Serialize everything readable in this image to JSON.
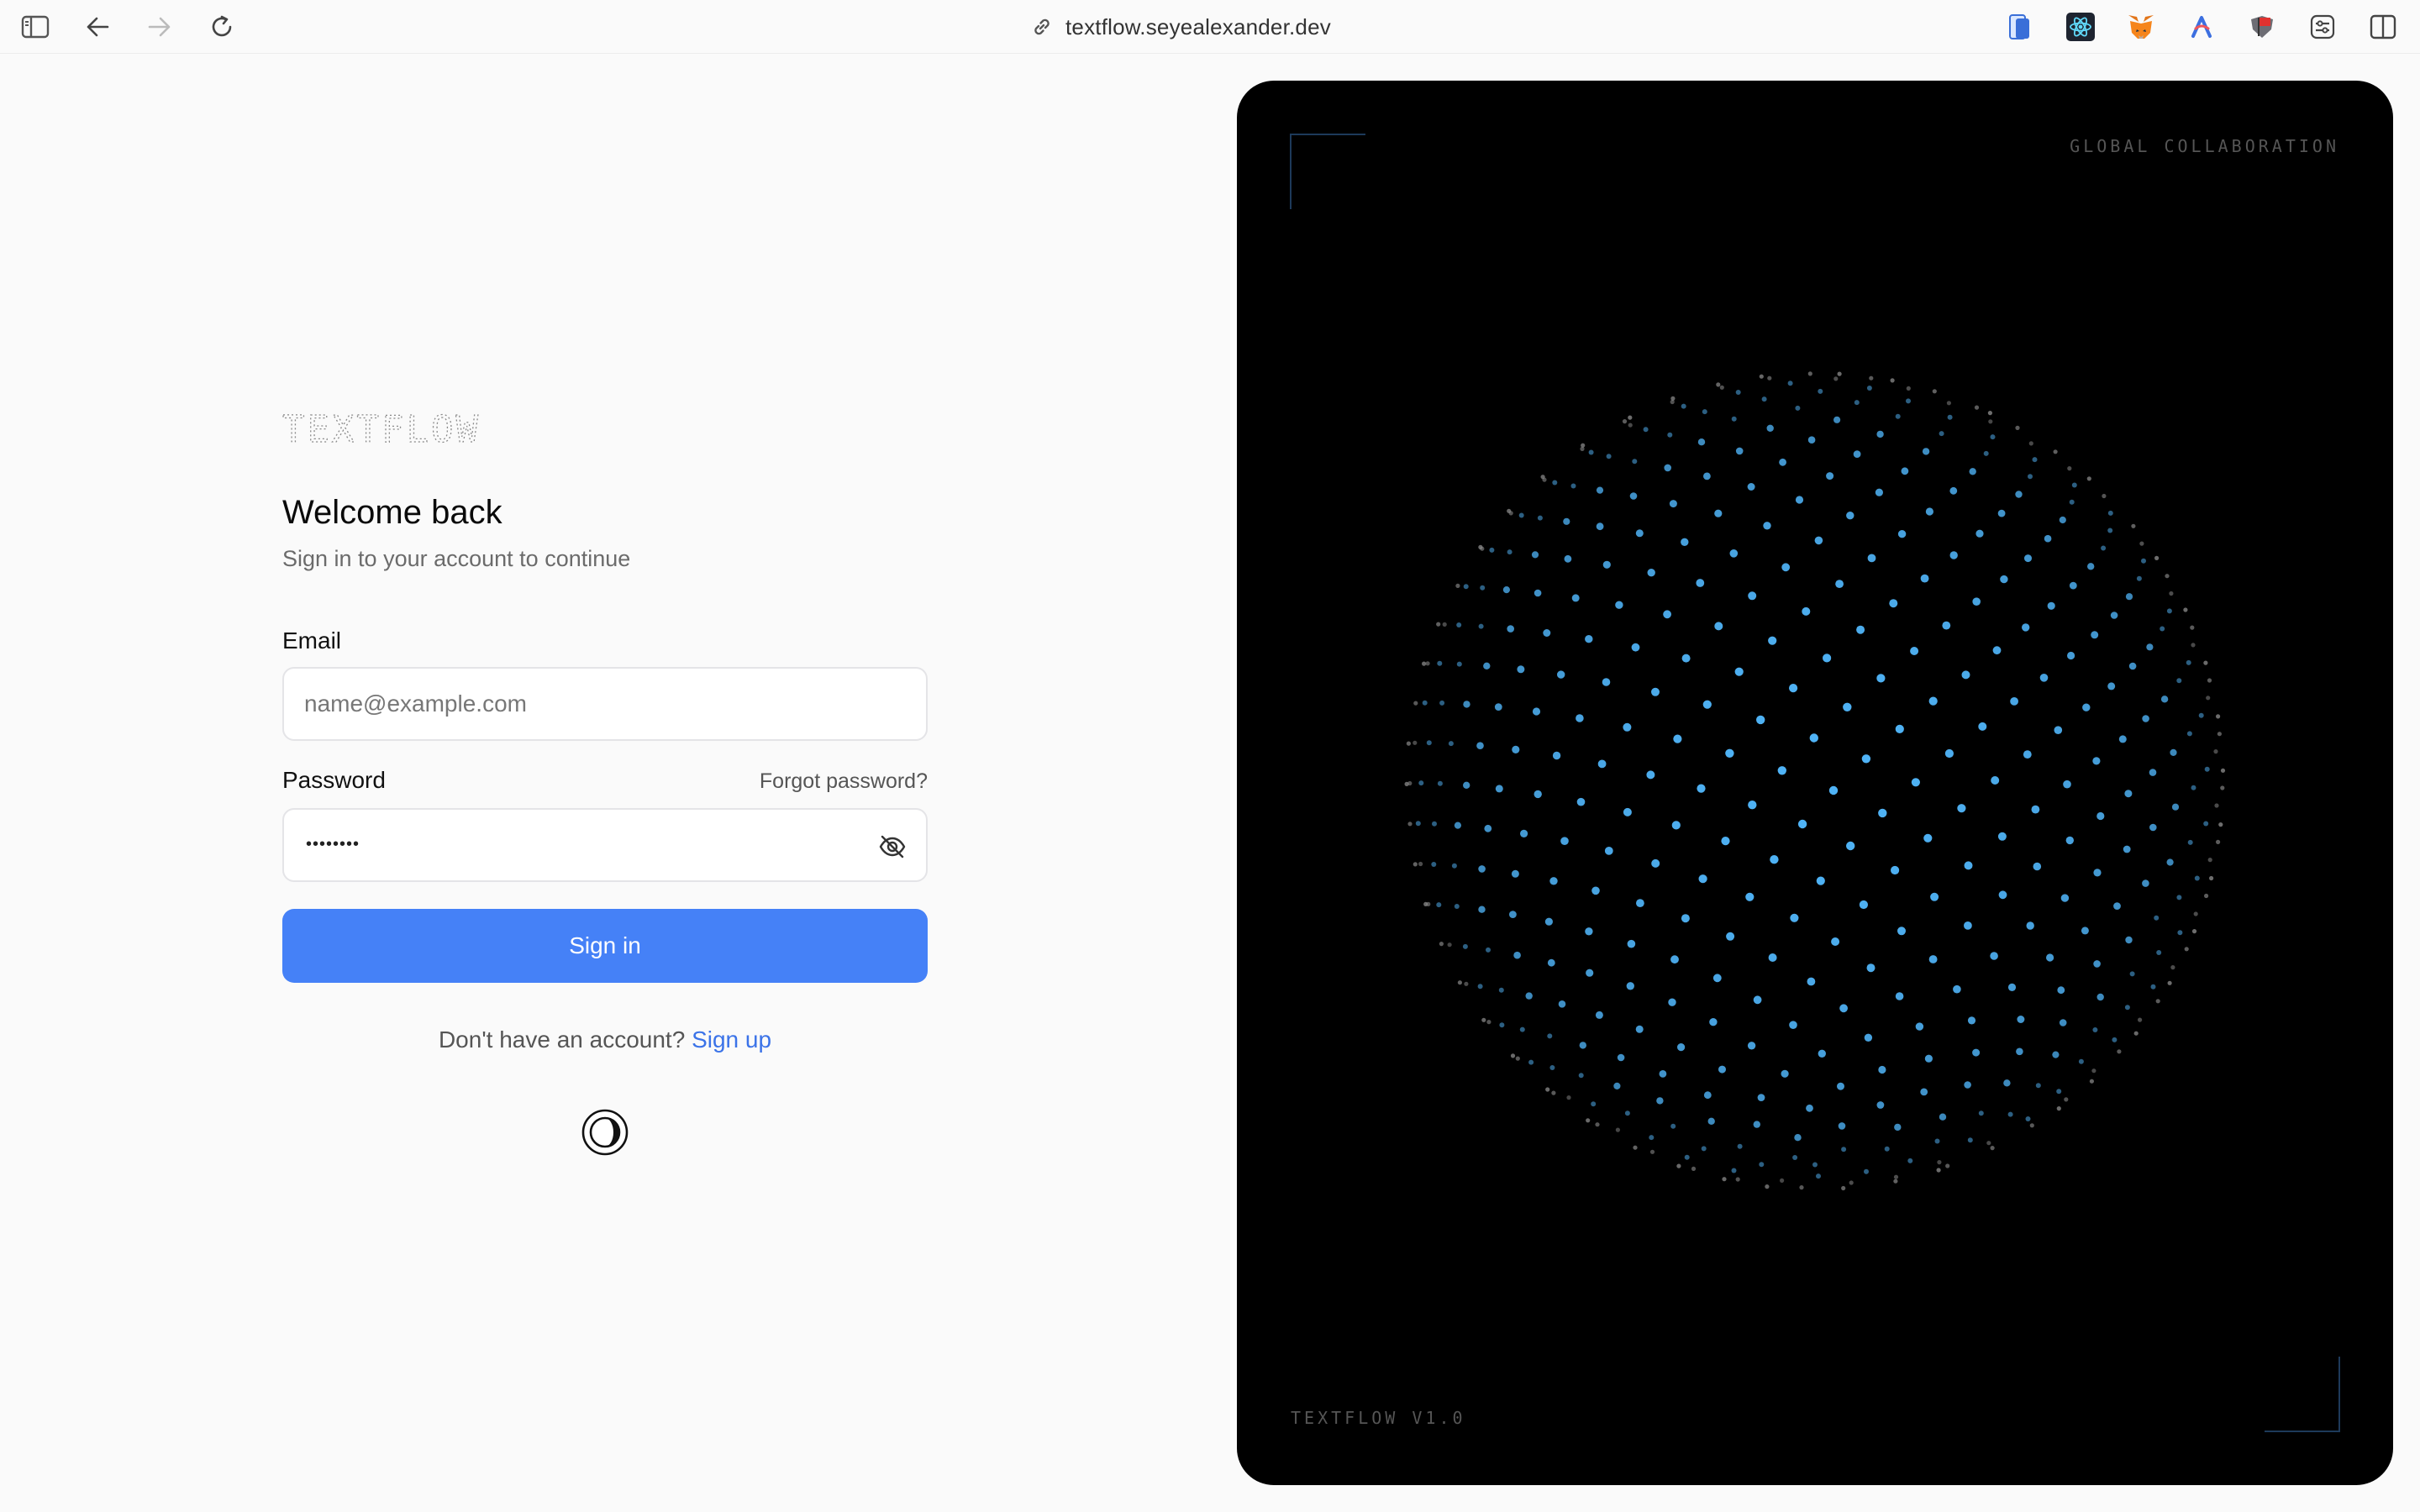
{
  "browser": {
    "url": "textflow.seyealexander.dev",
    "icons": [
      "sidebar-icon",
      "back-arrow-icon",
      "forward-arrow-icon",
      "reload-icon",
      "link-icon"
    ],
    "extensions": [
      "mobile-device-icon",
      "react-icon",
      "metamask-fox-icon",
      "arc-icon",
      "shield-flag-icon",
      "sliders-icon",
      "split-view-icon"
    ]
  },
  "login": {
    "logo_text": "TEXTFLOW",
    "title": "Welcome back",
    "subtitle": "Sign in to your account to continue",
    "email_label": "Email",
    "email_placeholder": "name@example.com",
    "email_value": "",
    "password_label": "Password",
    "forgot_password": "Forgot password?",
    "password_masked": "••••••••",
    "sign_in_label": "Sign in",
    "no_account_text": "Don't have an account?",
    "sign_up_label": "Sign up"
  },
  "visual": {
    "top_label": "GLOBAL COLLABORATION",
    "bottom_label": "TEXTFLOW V1.0"
  },
  "colors": {
    "accent": "#4581f7",
    "link": "#3b73e8",
    "dot_blue": "#4fb3f6",
    "dot_gray": "#8a8a8a",
    "panel_bg": "#000000"
  }
}
